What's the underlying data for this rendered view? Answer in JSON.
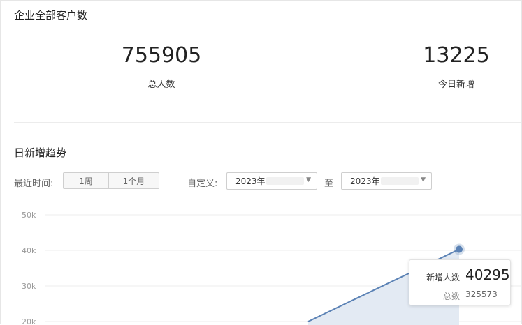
{
  "summary": {
    "title": "企业全部客户数",
    "total_value": "755905",
    "total_label": "总人数",
    "today_value": "13225",
    "today_label": "今日新增"
  },
  "trend": {
    "title": "日新增趋势",
    "recent_label": "最近时间:",
    "range_week": "1周",
    "range_month": "1个月",
    "custom_label": "自定义:",
    "start_date": "2023年",
    "to_label": "至",
    "end_date": "2023年"
  },
  "tooltip": {
    "new_label": "新增人数",
    "new_value": "40295",
    "total_label": "总数",
    "total_value": "325573"
  },
  "colors": {
    "line": "#5b82b5",
    "area": "#e3eaf3",
    "grid": "#ececec"
  },
  "chart_data": {
    "type": "area",
    "y_ticks": [
      "50k",
      "40k",
      "30k",
      "20k"
    ],
    "ylim": [
      20000,
      50000
    ],
    "series": [
      {
        "values": [
          20000,
          40295
        ]
      }
    ],
    "highlight_value": 40295
  }
}
